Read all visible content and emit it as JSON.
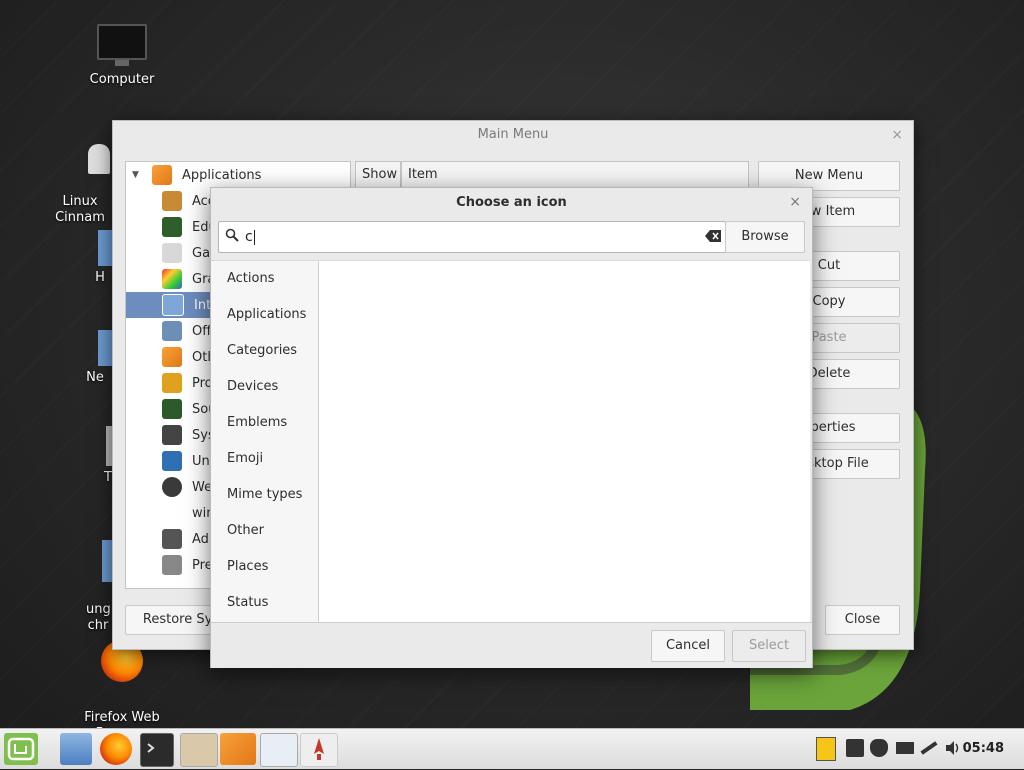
{
  "desktop": {
    "icons": [
      {
        "label": "Computer"
      },
      {
        "label": "Linux\nCinnam"
      },
      {
        "label": "H"
      },
      {
        "label": "Ne"
      },
      {
        "label": "T"
      },
      {
        "label": "ung\nchr"
      },
      {
        "label": "Firefox Web\nBrowser"
      }
    ]
  },
  "main_window": {
    "title": "Main Menu",
    "close_glyph": "×",
    "tree": {
      "root": "Applications",
      "items": [
        "Acc",
        "Edu",
        "Gar",
        "Gra",
        "Int",
        "Off",
        "Oth",
        "Pro",
        "Sou",
        "Sys",
        "Un",
        "We",
        "win",
        "Ad",
        "Pre"
      ]
    },
    "columns": {
      "show": "Show",
      "item": "Item"
    },
    "buttons": {
      "new_menu": "New Menu",
      "new_item": "ew Item",
      "cut": "Cut",
      "copy": "Copy",
      "paste": "Paste",
      "delete": "Delete",
      "properties": "operties",
      "desktop_file": "Desktop File",
      "restore": "Restore Sys",
      "close": "Close"
    }
  },
  "dialog": {
    "title": "Choose an icon",
    "close_glyph": "×",
    "search": {
      "value": "c",
      "browse_label": "Browse"
    },
    "categories": [
      "Actions",
      "Applications",
      "Categories",
      "Devices",
      "Emblems",
      "Emoji",
      "Mime types",
      "Other",
      "Places",
      "Status"
    ],
    "buttons": {
      "cancel": "Cancel",
      "select": "Select"
    }
  },
  "taskbar": {
    "clock": "05:48"
  }
}
